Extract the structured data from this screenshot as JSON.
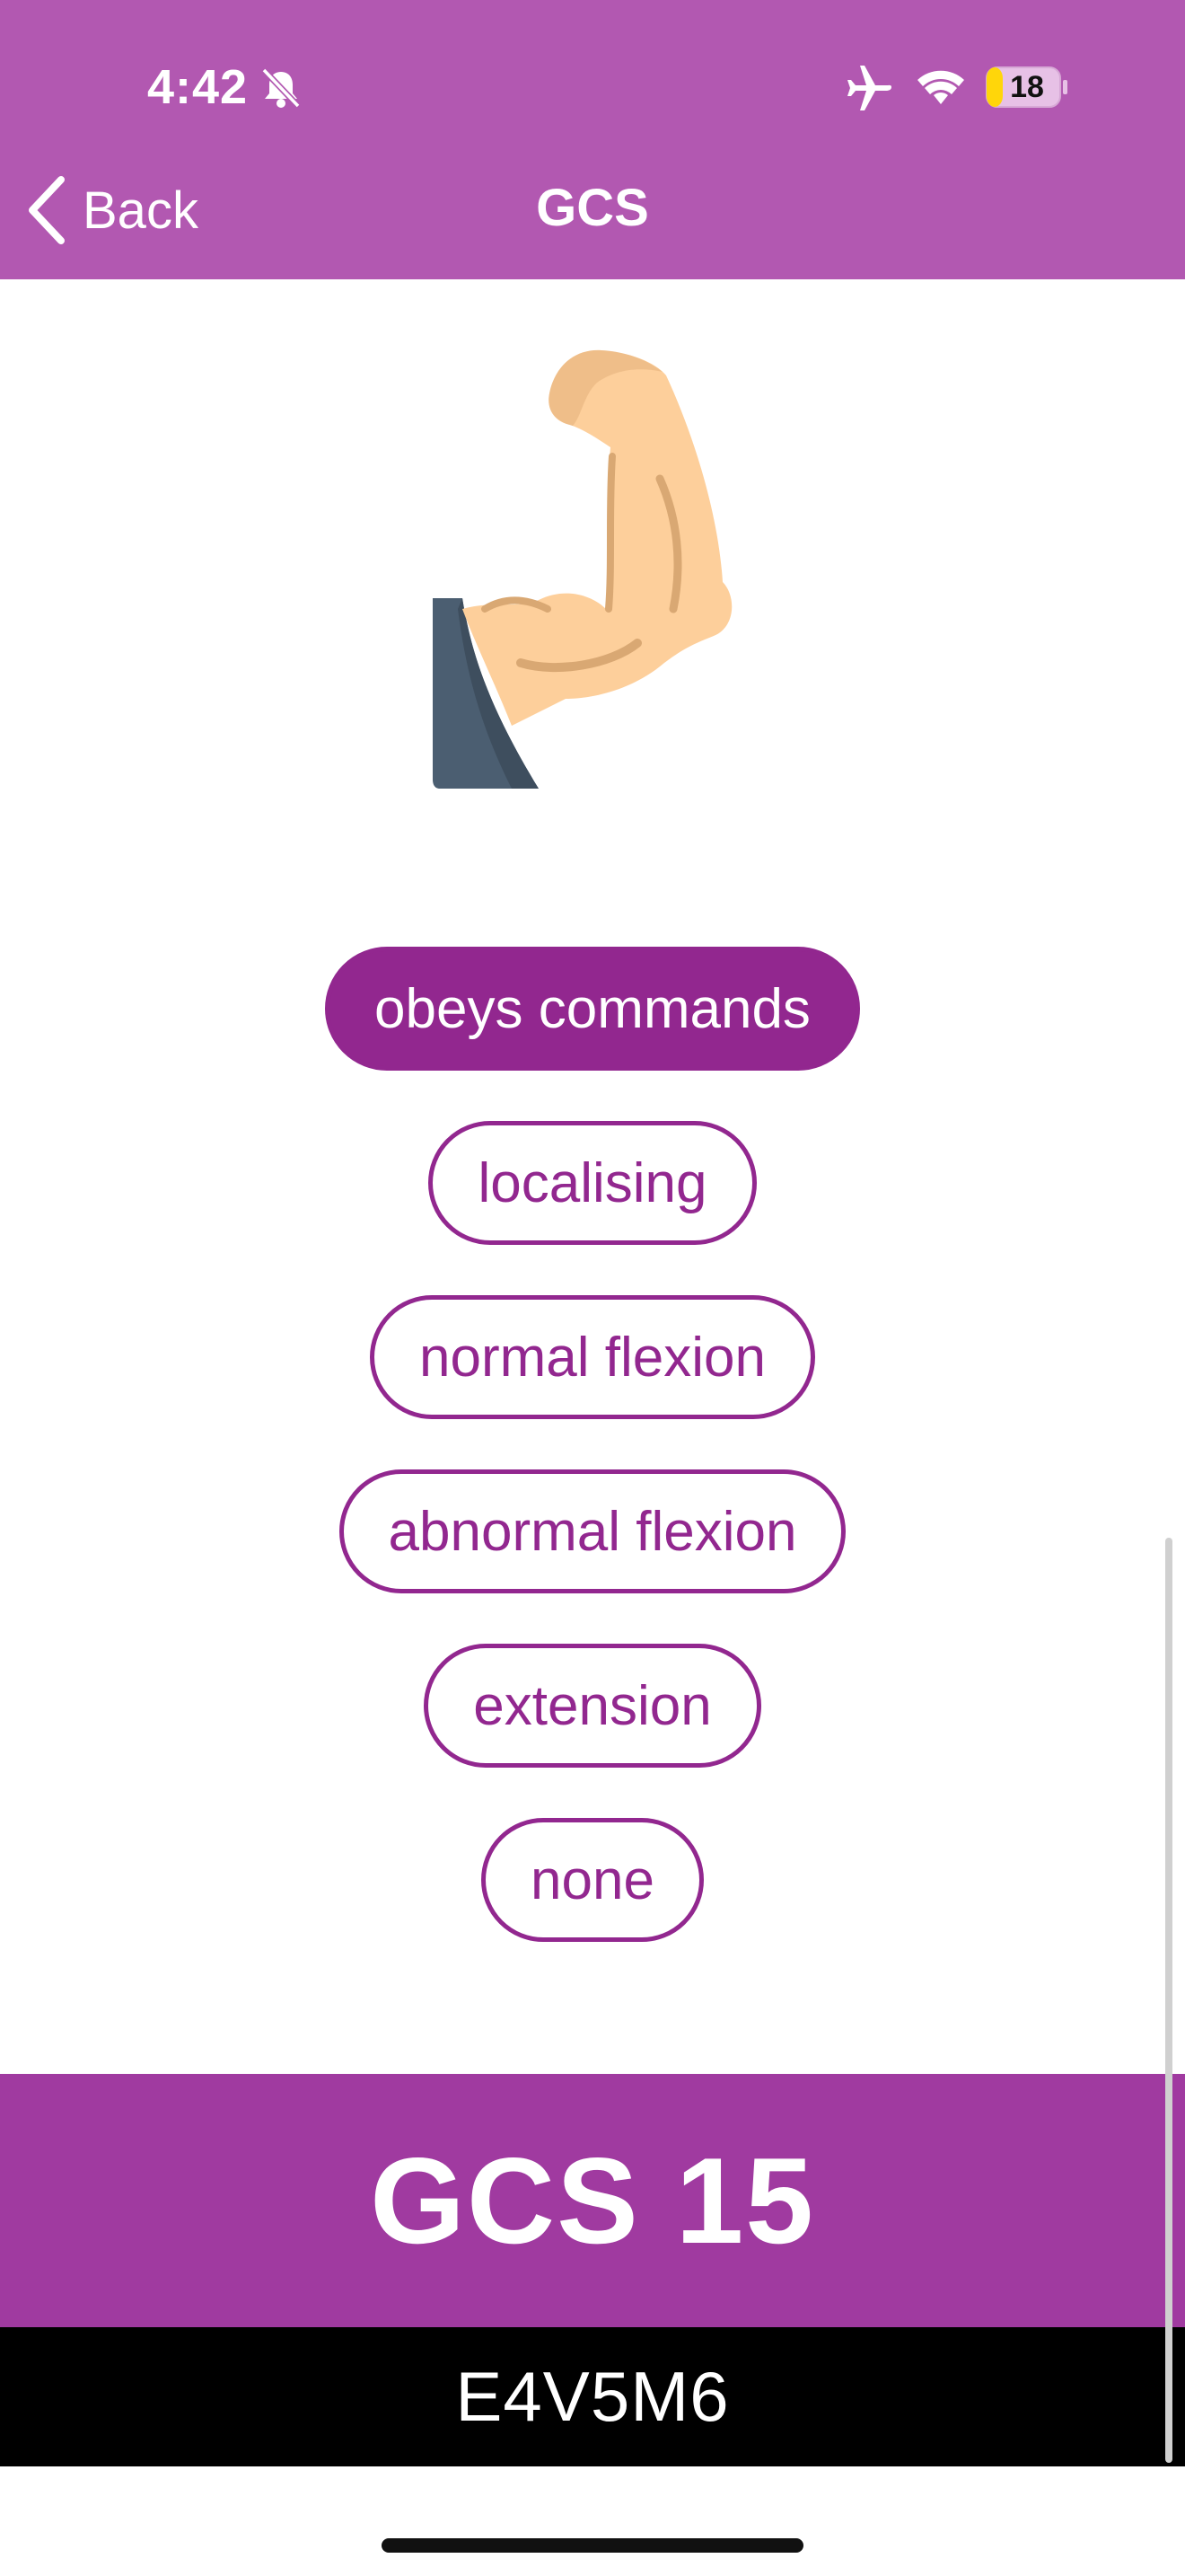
{
  "status_bar": {
    "time": "4:42",
    "battery_level": "18",
    "icons": [
      "bell-slash-icon",
      "airplane-icon",
      "wifi-icon",
      "battery-icon"
    ]
  },
  "nav": {
    "back_label": "Back",
    "title": "GCS"
  },
  "illustration": "flexed-arm-icon",
  "options": [
    {
      "label": "obeys commands",
      "selected": true
    },
    {
      "label": "localising",
      "selected": false
    },
    {
      "label": "normal flexion",
      "selected": false
    },
    {
      "label": "abnormal flexion",
      "selected": false
    },
    {
      "label": "extension",
      "selected": false
    },
    {
      "label": "none",
      "selected": false
    }
  ],
  "result": {
    "score": "GCS 15",
    "breakdown": "E4V5M6"
  },
  "colors": {
    "header": "#b258b1",
    "accent": "#92278f",
    "score_bar": "#a03aa0",
    "breakdown_bar": "#000000"
  }
}
